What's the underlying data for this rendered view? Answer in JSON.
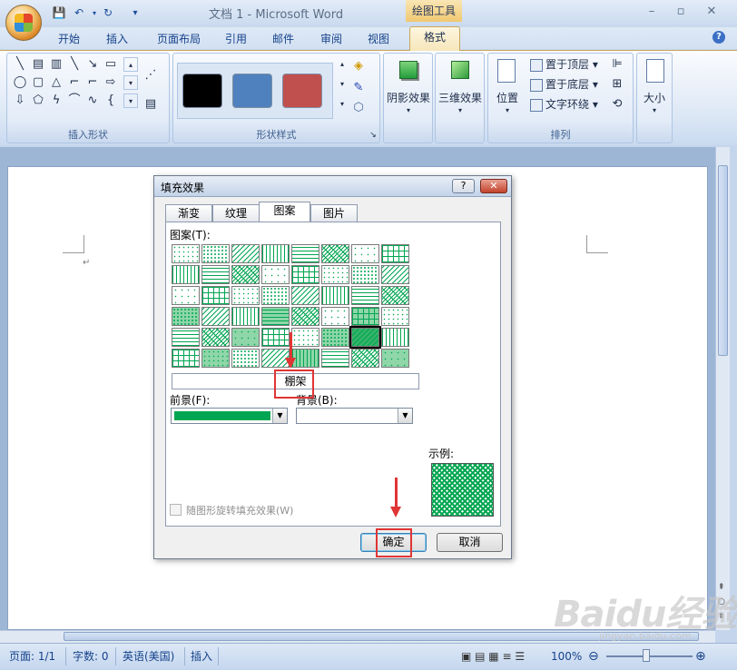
{
  "window": {
    "title": "文档 1 - Microsoft Word",
    "context_tab_group": "绘图工具",
    "minimize": "–",
    "maximize": "▫",
    "close": "✕",
    "help": "?"
  },
  "tabs": [
    {
      "label": "开始"
    },
    {
      "label": "插入"
    },
    {
      "label": "页面布局"
    },
    {
      "label": "引用"
    },
    {
      "label": "邮件"
    },
    {
      "label": "审阅"
    },
    {
      "label": "视图"
    },
    {
      "label": "格式"
    }
  ],
  "ribbon": {
    "groups": {
      "insert_shapes": "插入形状",
      "shape_styles": "形状样式",
      "shadow_effects": "阴影效果",
      "threed_effects": "三维效果",
      "arrange": "排列",
      "size": "大小"
    },
    "arrange_items": {
      "position": "位置",
      "bring_front": "置于顶层",
      "send_back": "置于底层",
      "text_wrap": "文字环绕"
    },
    "style_swatches": [
      "#000000",
      "#4e81bd",
      "#c0504d"
    ]
  },
  "dialog": {
    "title": "填充效果",
    "help_btn": "?",
    "close_btn": "✕",
    "tabs": [
      "渐变",
      "纹理",
      "图案",
      "图片"
    ],
    "active_tab": "图案",
    "pattern_label": "图案(T):",
    "selected_pattern_name": "棚架",
    "foreground_label": "前景(F):",
    "background_label": "背景(B):",
    "foreground_color": "#00a651",
    "sample_label": "示例:",
    "rotate_checkbox": "随图形旋转填充效果(W)",
    "ok": "确定",
    "cancel": "取消"
  },
  "status": {
    "page": "页面: 1/1",
    "words": "字数: 0",
    "language": "英语(美国)",
    "insert": "插入",
    "zoom": "100%"
  },
  "watermark": {
    "brand": "Baidu经验",
    "url": "jingyan.baidu.com"
  },
  "colors": {
    "pattern_green": "#00a651",
    "annotation_red": "#e03535"
  }
}
